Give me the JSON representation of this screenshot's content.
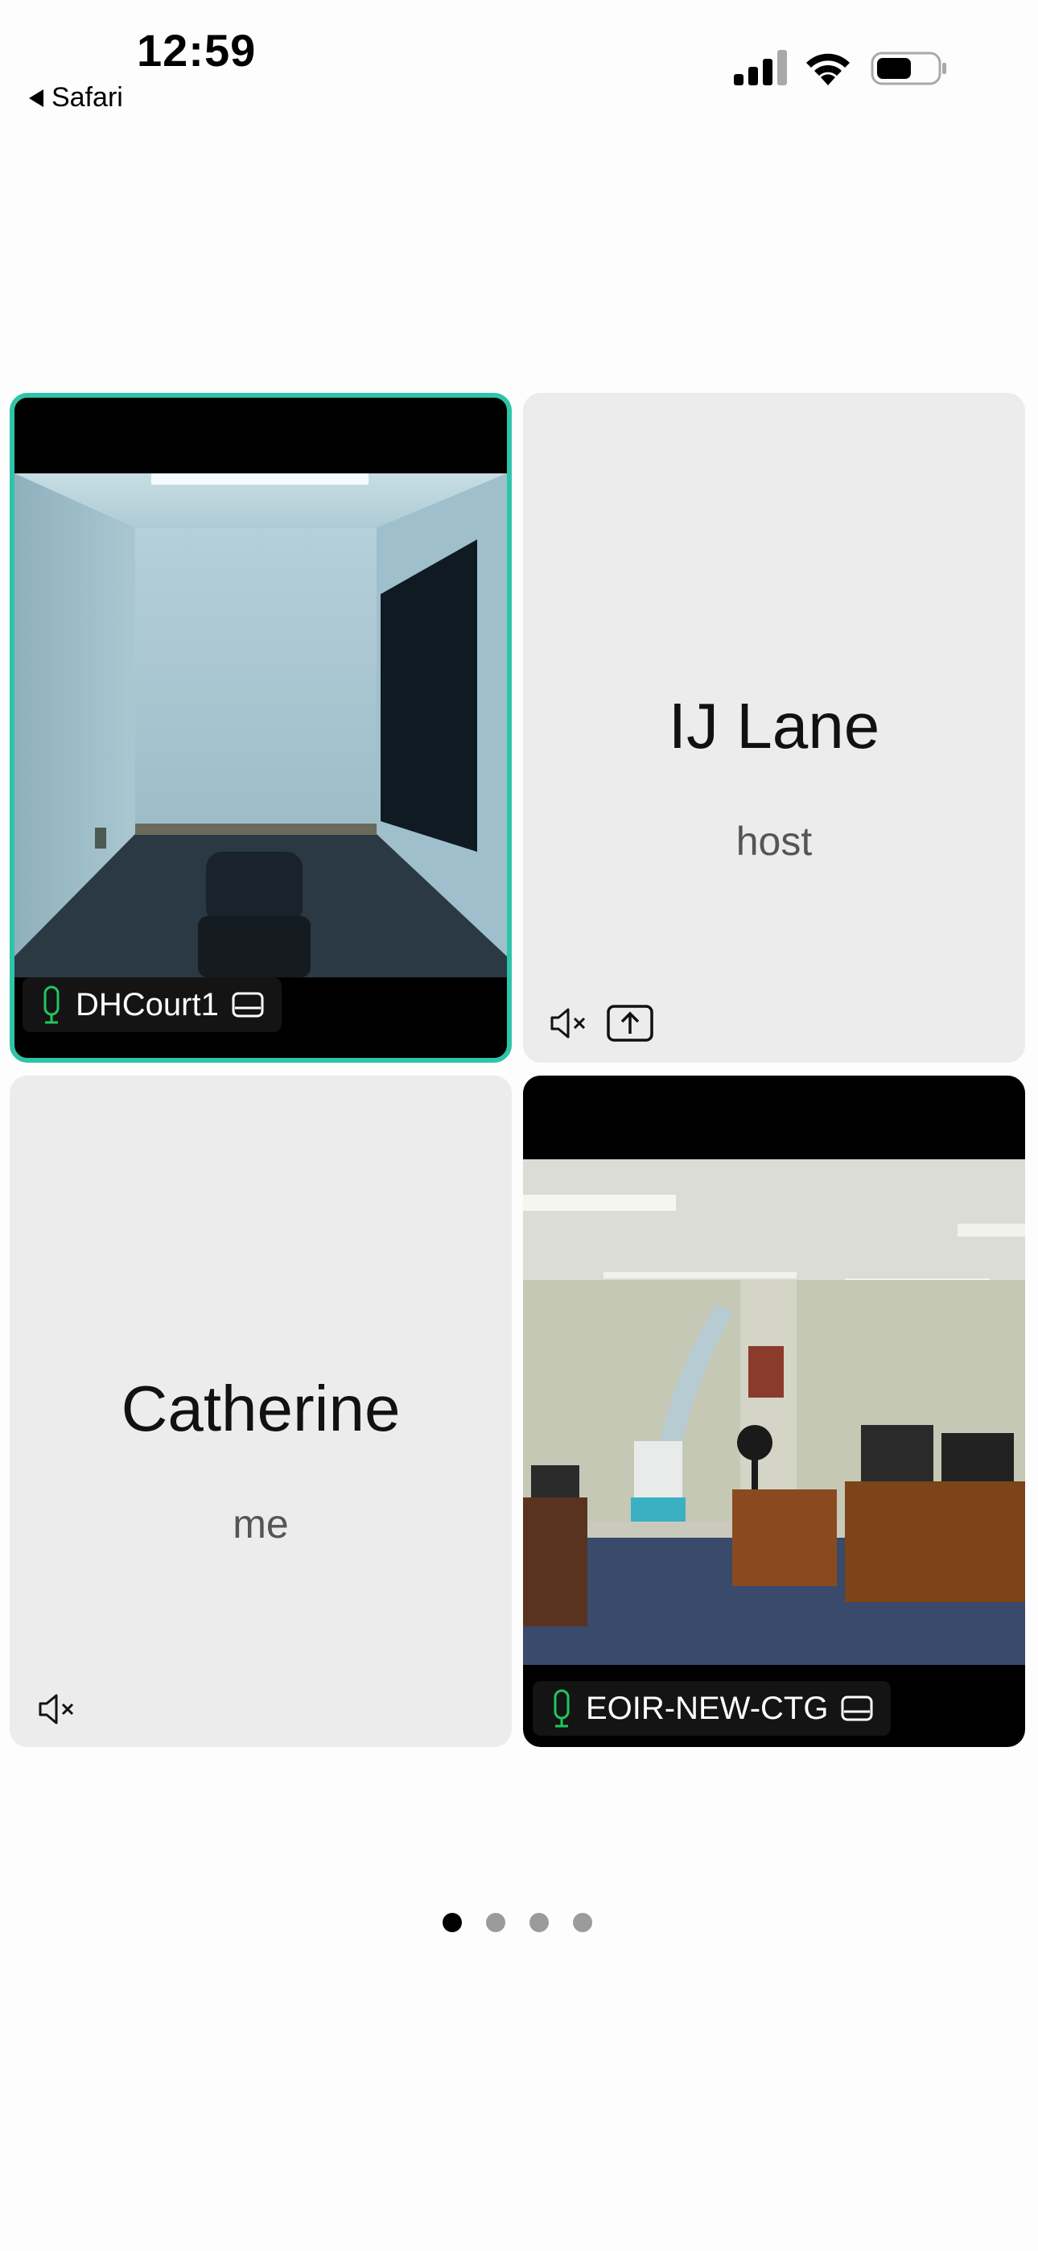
{
  "status_bar": {
    "time": "12:59",
    "back_app": "Safari"
  },
  "participants": [
    {
      "name": "DHCourt1",
      "role": "",
      "video": true,
      "speaking": true,
      "mic": "on"
    },
    {
      "name": "IJ Lane",
      "role": "host",
      "video": false,
      "mic": "muted"
    },
    {
      "name": "Catherine",
      "role": "me",
      "video": false,
      "mic": "muted"
    },
    {
      "name": "EOIR-NEW-CTG",
      "role": "",
      "video": true,
      "mic": "on"
    }
  ],
  "pagination": {
    "pages": 4,
    "current": 1
  },
  "colors": {
    "active_border": "#2ec4a9",
    "mic_on": "#22c55e",
    "tile_bg": "#ececec"
  }
}
